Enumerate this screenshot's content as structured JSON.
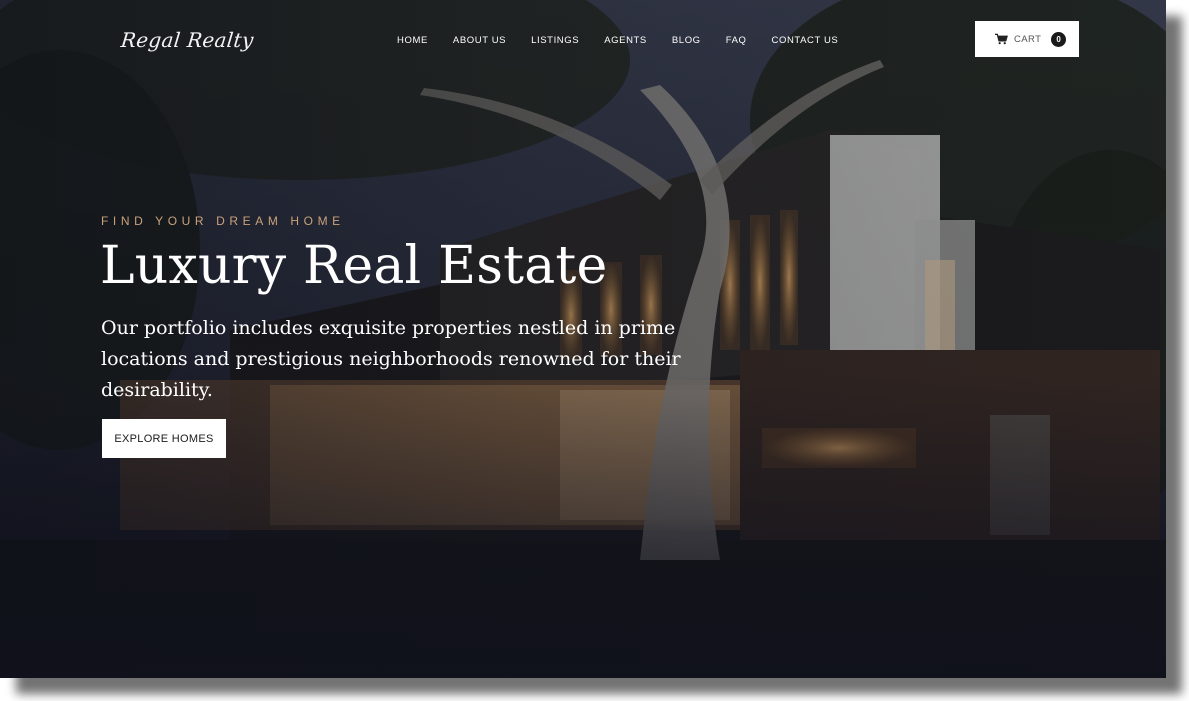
{
  "brand": {
    "logo_text": "Regal Realty"
  },
  "nav": {
    "items": [
      {
        "label": "HOME"
      },
      {
        "label": "ABOUT US"
      },
      {
        "label": "LISTINGS"
      },
      {
        "label": "AGENTS"
      },
      {
        "label": "BLOG"
      },
      {
        "label": "FAQ"
      },
      {
        "label": "CONTACT US"
      }
    ]
  },
  "cart": {
    "label": "CART",
    "count": "0",
    "icon": "cart-icon"
  },
  "hero": {
    "eyebrow": "FIND YOUR DREAM HOME",
    "title": "Luxury Real Estate",
    "subtitle": "Our portfolio includes exquisite properties nestled in prime locations and prestigious neighborhoods renowned for their desirability.",
    "cta_label": "EXPLORE HOMES"
  },
  "colors": {
    "accent": "#c9a27a",
    "background": "#141722",
    "button_bg": "#ffffff"
  }
}
